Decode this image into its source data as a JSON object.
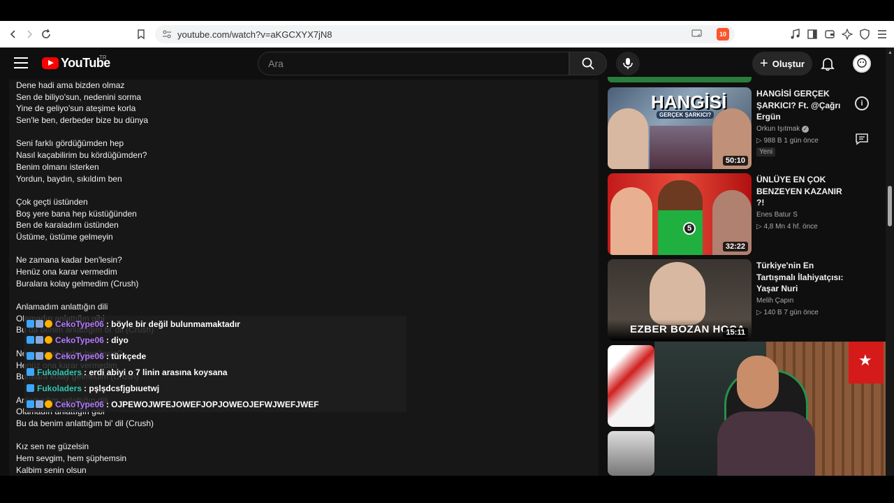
{
  "browser": {
    "url": "youtube.com/watch?v=aKGCXYX7jN8",
    "brave_count": "10"
  },
  "header": {
    "logo_text": "YouTube",
    "country": "TR",
    "search_placeholder": "Ara",
    "create_label": "Oluştur"
  },
  "lyrics": [
    "Dene hadi ama bizden olmaz",
    "Sen de biliyo'sun, nedenini sorma",
    "Yine de geliyo'sun ateşime korla",
    "Sen'le ben, derbeder bize bu dünya",
    "",
    "Seni farklı gördüğümden hep",
    "Nasıl kaçabilirim bu kördüğümden?",
    "Benim olmanı isterken",
    "Yordun, baydın, sıkıldım ben",
    "",
    "Çok geçti üstünden",
    "Boş yere bana hep küstüğünden",
    "Ben de karaladım üstünden",
    "Üstüme, üstüme gelmeyin",
    "",
    "Ne zamana kadar ben'lesin?",
    "Henüz ona karar vermedim",
    "Buralara kolay gelmedim (Crush)",
    "",
    "Anlamadım anlattığın dili",
    "Olamadın anlattığın gibi",
    "Bu da benim anlattığım bi' dil (Crush)",
    "",
    "Ne zamana kadar ben'lesin?",
    "Henüz ona karar vermedim",
    "Buralara kolay gelmedim (Crush)",
    "",
    "Anlamadım anlattığın dili",
    "Olamadın anlattığın gibi",
    "Bu da benim anlattığım bi' dil (Crush)",
    "",
    "Kız sen ne güzelsin",
    "Hem sevgim, hem şüphemsin",
    "Kalbim senin olsun"
  ],
  "chat": [
    {
      "user": "CekoType06",
      "msg": ": böyle bir değil bulunmamaktadır",
      "color": "purple",
      "badges": 3
    },
    {
      "user": "CekoType06",
      "msg": ": diyo",
      "color": "purple",
      "badges": 3
    },
    {
      "user": "CekoType06",
      "msg": ": türkçede",
      "color": "purple",
      "badges": 3
    },
    {
      "user": "Fukoladers",
      "msg": ": erdi abiyi o 7 linin arasına koysana",
      "color": "green",
      "badges": 1
    },
    {
      "user": "Fukoladers",
      "msg": ": pşlşdcsfjgbıuetwj",
      "color": "green",
      "badges": 1
    },
    {
      "user": "CekoType06",
      "msg": ": OJPEWOJWFEJOWEFJOPJOWEOJEFWJWEFJWEF",
      "color": "purple",
      "badges": 3
    }
  ],
  "videos": [
    {
      "title": "HANGİSİ GERÇEK ŞARKICI? Ft. @Çağrı Ergün",
      "channel": "Orkun Işıtmak",
      "meta": "▷ 988 B  1 gün önce",
      "duration": "50:10",
      "badge": "Yeni",
      "thumb_text": "HANGİSİ",
      "thumb_sub": "GERÇEK ŞARKICI?"
    },
    {
      "title": "ÜNLÜYE EN ÇOK BENZEYEN KAZANIR ?!",
      "channel": "Enes Batur S",
      "meta": "▷ 4,8 Mn  4 hf. önce",
      "duration": "32:22",
      "thumb_number": "5"
    },
    {
      "title": "Türkiye'nin En Tartışmalı İlahiyatçısı: Yaşar Nuri",
      "channel": "Melih Çapın",
      "meta": "▷ 140 B  7 gün önce",
      "duration": "15:11",
      "thumb_text": "EZBER BOZAN HOCA"
    }
  ],
  "colors": {
    "bg": "#0f0f0f",
    "accent": "#ff0000",
    "chat_purple": "#b277ff",
    "chat_green": "#2fc8b0"
  }
}
